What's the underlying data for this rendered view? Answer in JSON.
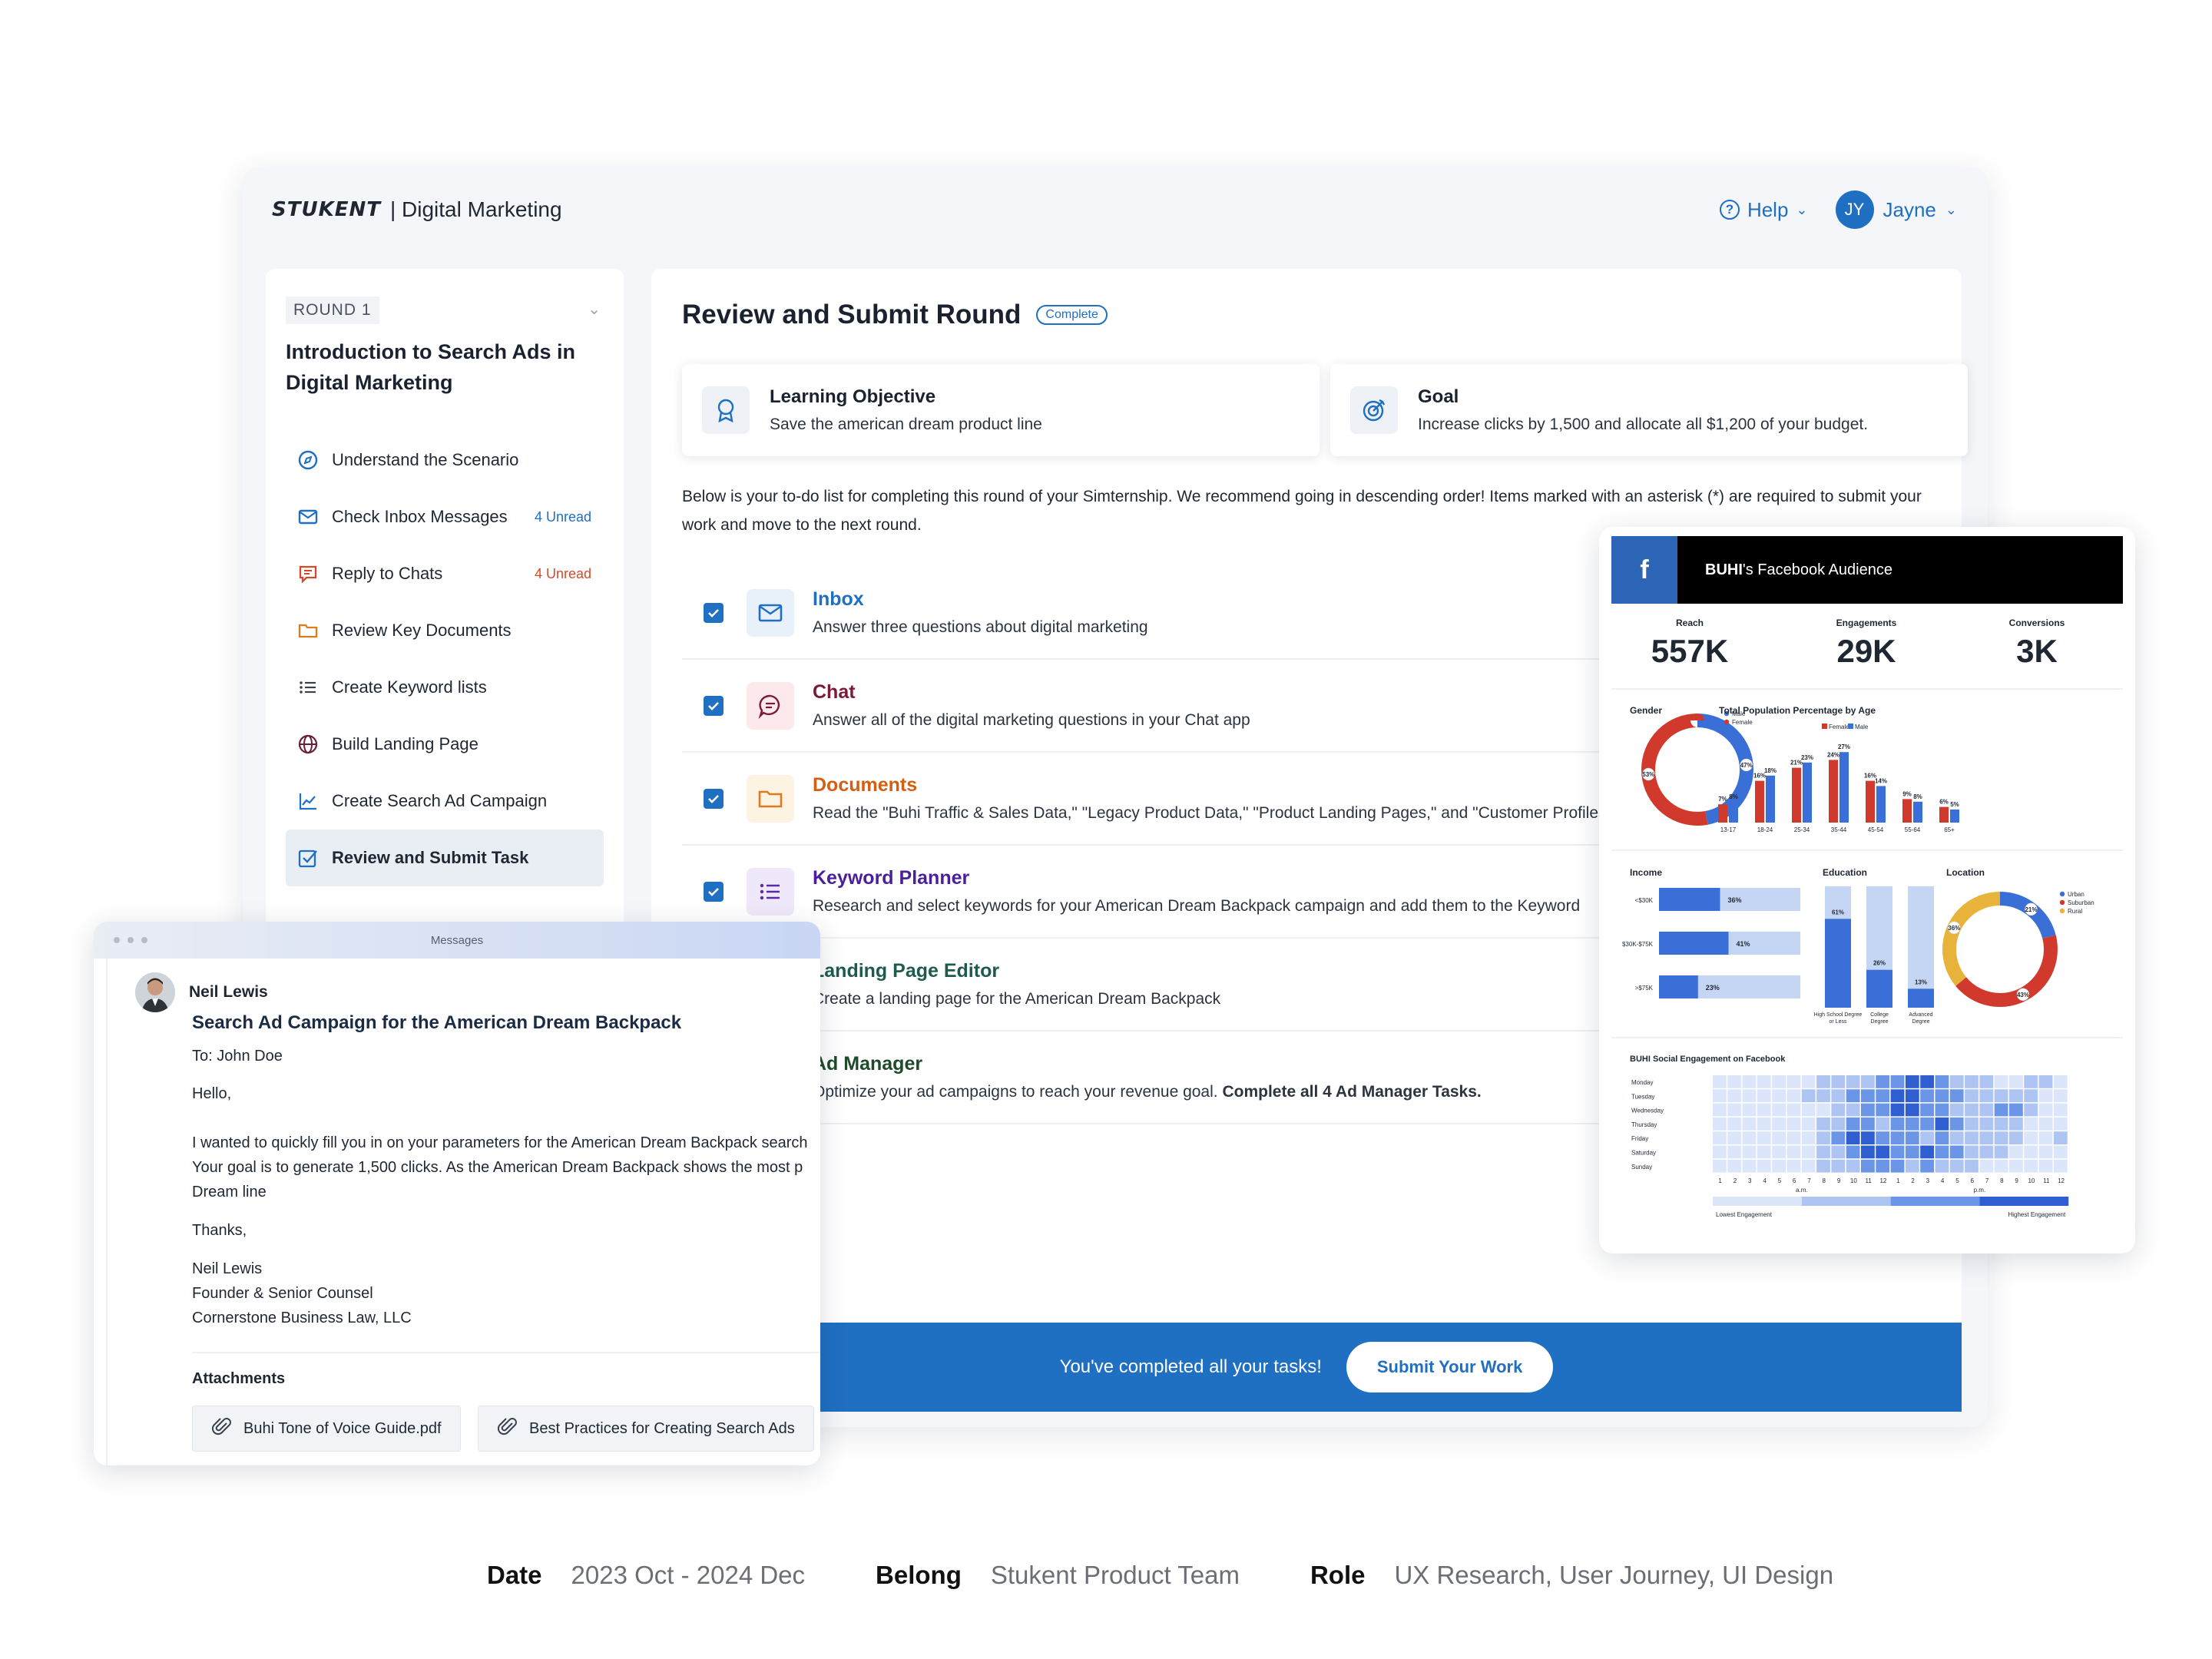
{
  "app": {
    "brand": "STUKENT",
    "product": "| Digital Marketing",
    "help_label": "Help",
    "user_initials": "JY",
    "user_name": "Jayne"
  },
  "sidebar": {
    "round_label": "ROUND 1",
    "title": "Introduction to Search Ads in Digital Marketing",
    "items": [
      {
        "label": "Understand the Scenario",
        "icon": "compass-icon",
        "badge": ""
      },
      {
        "label": "Check Inbox Messages",
        "icon": "mail-icon",
        "badge": "4 Unread"
      },
      {
        "label": "Reply to Chats",
        "icon": "chat-icon",
        "badge": "4 Unread"
      },
      {
        "label": "Review Key Documents",
        "icon": "folder-icon",
        "badge": ""
      },
      {
        "label": "Create Keyword lists",
        "icon": "list-icon",
        "badge": ""
      },
      {
        "label": "Build Landing Page",
        "icon": "globe-icon",
        "badge": ""
      },
      {
        "label": "Create Search Ad Campaign",
        "icon": "chart-line-icon",
        "badge": ""
      },
      {
        "label": "Review and Submit Task",
        "icon": "check-square-icon",
        "badge": "",
        "active": true
      }
    ]
  },
  "main": {
    "title": "Review and Submit Round",
    "status_badge": "Complete",
    "objective": {
      "title": "Learning Objective",
      "text": "Save the american dream product line"
    },
    "goal": {
      "title": "Goal",
      "text": "Increase clicks by 1,500 and allocate all $1,200 of your budget."
    },
    "intro": "Below is your to-do list for completing this round of your Simternship. We recommend going in descending order! Items marked with an asterisk (*) are required to submit your work and move to the next round.",
    "tasks": [
      {
        "title": "Inbox",
        "text": "Answer three questions about digital marketing",
        "checked": true
      },
      {
        "title": "Chat",
        "text": "Answer all of the digital marketing questions in your Chat app",
        "checked": true
      },
      {
        "title": "Documents",
        "text": "Read the \"Buhi Traffic & Sales Data,\" \"Legacy Product Data,\" \"Product Landing Pages,\" and \"Customer Profiles\"",
        "checked": true
      },
      {
        "title": "Keyword Planner",
        "text": "Research and select keywords for your American Dream Backpack campaign and add them to the Keyword",
        "checked": true
      },
      {
        "title": "Landing Page Editor",
        "text": "Create a landing page for the American Dream Backpack",
        "checked": true
      },
      {
        "title": "Ad Manager",
        "text": "Optimize your ad campaigns to reach your revenue goal.",
        "text_bold": "Complete all 4 Ad Manager Tasks.",
        "checked": true
      }
    ],
    "submit_message": "You've completed all your tasks!",
    "submit_button": "Submit Your Work"
  },
  "messages": {
    "window_title": "Messages",
    "sender": "Neil Lewis",
    "subject": "Search Ad Campaign for the American Dream Backpack",
    "to": "To: John Doe",
    "greeting": "Hello,",
    "body_line1": "I wanted to quickly fill you in on your parameters for the American Dream Backpack search",
    "body_line2": "Your goal is to generate 1,500 clicks. As the American Dream Backpack shows the most p",
    "body_line3": "Dream line",
    "closing": "Thanks,",
    "sig_name": "Neil Lewis",
    "sig_title": "Founder & Senior Counsel",
    "sig_company": "Cornerstone Business Law, LLC",
    "attachments_label": "Attachments",
    "attachments": [
      "Buhi Tone of Voice Guide.pdf",
      "Best Practices for Creating Search Ads"
    ]
  },
  "facebook": {
    "title_bold": "BUHI",
    "title_rest": "'s Facebook Audience",
    "stats": [
      {
        "label": "Reach",
        "value": "557K"
      },
      {
        "label": "Engagements",
        "value": "29K"
      },
      {
        "label": "Conversions",
        "value": "3K"
      }
    ]
  },
  "chart_data": [
    {
      "type": "pie",
      "title": "Gender",
      "categories": [
        "Male",
        "Female"
      ],
      "values": [
        47,
        53
      ],
      "colors": [
        "#3a6fd8",
        "#d0392b"
      ]
    },
    {
      "type": "bar",
      "title": "Total Population Percentage by Age",
      "categories": [
        "13-17",
        "18-24",
        "25-34",
        "35-44",
        "45-54",
        "55-64",
        "65+"
      ],
      "series": [
        {
          "name": "Female",
          "values": [
            7,
            16,
            21,
            24,
            16,
            9,
            6
          ]
        },
        {
          "name": "Male",
          "values": [
            8,
            18,
            23,
            27,
            14,
            8,
            5
          ]
        }
      ],
      "colors": [
        "#d0392b",
        "#3a6fd8"
      ]
    },
    {
      "type": "bar",
      "title": "Income",
      "categories": [
        "<$30K",
        "$30K-$75K",
        ">$75K"
      ],
      "values": [
        36,
        41,
        23
      ],
      "ylim": [
        0,
        100
      ]
    },
    {
      "type": "bar",
      "title": "Education",
      "categories": [
        "High School Degree or Less",
        "College Degree",
        "Advanced Degree"
      ],
      "values": [
        61,
        26,
        13
      ],
      "ylim": [
        0,
        100
      ]
    },
    {
      "type": "pie",
      "title": "Location",
      "categories": [
        "Urban",
        "Suburban",
        "Rural"
      ],
      "values": [
        21,
        43,
        36
      ],
      "colors": [
        "#3a6fd8",
        "#d0392b",
        "#e8b33a"
      ]
    },
    {
      "type": "heatmap",
      "title": "BUHI Social Engagement on Facebook",
      "rows": [
        "Monday",
        "Tuesday",
        "Wednesday",
        "Thursday",
        "Friday",
        "Saturday",
        "Sunday"
      ],
      "columns": [
        "1",
        "2",
        "3",
        "4",
        "5",
        "6",
        "7",
        "8",
        "9",
        "10",
        "11",
        "12",
        "1",
        "2",
        "3",
        "4",
        "5",
        "6",
        "7",
        "8",
        "9",
        "10",
        "11",
        "12"
      ],
      "column_groups": [
        "a.m.",
        "p.m."
      ],
      "levels": [
        [
          0,
          0,
          0,
          0,
          0,
          0,
          0,
          1,
          1,
          1,
          1,
          2,
          2,
          3,
          3,
          2,
          1,
          1,
          1,
          0,
          0,
          1,
          1,
          0
        ],
        [
          0,
          0,
          0,
          0,
          0,
          0,
          1,
          1,
          1,
          2,
          2,
          2,
          3,
          3,
          2,
          2,
          2,
          1,
          1,
          1,
          1,
          1,
          0,
          0
        ],
        [
          0,
          0,
          0,
          0,
          0,
          0,
          0,
          0,
          1,
          1,
          2,
          2,
          3,
          3,
          2,
          2,
          1,
          1,
          1,
          2,
          2,
          1,
          0,
          0
        ],
        [
          0,
          0,
          0,
          0,
          0,
          0,
          0,
          1,
          1,
          2,
          2,
          1,
          2,
          2,
          2,
          3,
          2,
          1,
          1,
          1,
          1,
          0,
          0,
          0
        ],
        [
          0,
          0,
          0,
          0,
          0,
          0,
          0,
          1,
          2,
          3,
          3,
          2,
          2,
          2,
          1,
          2,
          1,
          1,
          1,
          1,
          1,
          0,
          0,
          1
        ],
        [
          0,
          0,
          0,
          0,
          0,
          0,
          0,
          1,
          1,
          2,
          3,
          3,
          2,
          2,
          3,
          2,
          2,
          1,
          1,
          1,
          0,
          0,
          0,
          0
        ],
        [
          0,
          0,
          0,
          0,
          0,
          0,
          0,
          1,
          1,
          1,
          2,
          2,
          2,
          1,
          2,
          1,
          1,
          1,
          0,
          0,
          0,
          0,
          0,
          0
        ]
      ],
      "legend": [
        "Lowest Engagement",
        "Highest Engagement"
      ]
    }
  ],
  "footer": {
    "date_label": "Date",
    "date_value": "2023  Oct - 2024 Dec",
    "belong_label": "Belong",
    "belong_value": "Stukent Product Team",
    "role_label": "Role",
    "role_value": "UX Research, User Journey, UI Design"
  }
}
